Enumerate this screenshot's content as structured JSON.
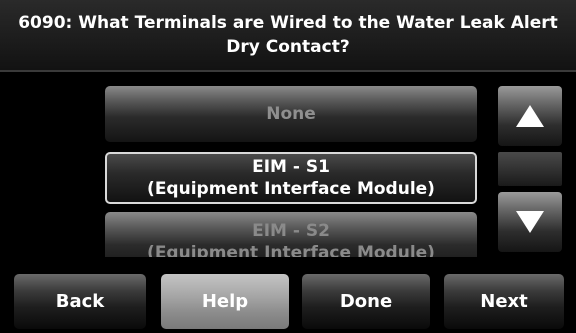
{
  "header": {
    "title": "6090: What Terminals are Wired to the Water Leak Alert Dry Contact?"
  },
  "options": [
    {
      "line1": "None",
      "line2": "",
      "selected": false
    },
    {
      "line1": "EIM - S1",
      "line2": "(Equipment Interface Module)",
      "selected": true
    },
    {
      "line1": "EIM - S2",
      "line2": "(Equipment Interface Module)",
      "selected": false
    }
  ],
  "scroll": {
    "up_icon": "triangle-up",
    "down_icon": "triangle-down"
  },
  "footer": {
    "back_label": "Back",
    "help_label": "Help",
    "done_label": "Done",
    "next_label": "Next"
  },
  "colors": {
    "background": "#000000",
    "text": "#ffffff",
    "selected_border": "#d9d9d9"
  }
}
